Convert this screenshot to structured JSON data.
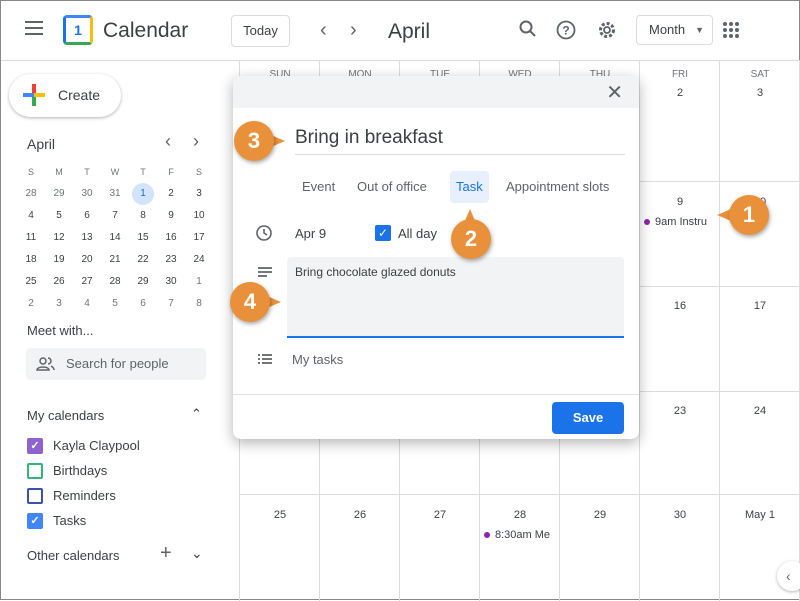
{
  "header": {
    "app_title": "Calendar",
    "logo_number": "1",
    "today_label": "Today",
    "month_label": "April",
    "view_label": "Month",
    "prev": "‹",
    "next": "›"
  },
  "sidebar": {
    "create_label": "Create",
    "mini_calendar": {
      "month": "April",
      "weekdays": [
        "S",
        "M",
        "T",
        "W",
        "T",
        "F",
        "S"
      ],
      "weeks": [
        [
          "28",
          "29",
          "30",
          "31",
          "1",
          "2",
          "3"
        ],
        [
          "4",
          "5",
          "6",
          "7",
          "8",
          "9",
          "10"
        ],
        [
          "11",
          "12",
          "13",
          "14",
          "15",
          "16",
          "17"
        ],
        [
          "18",
          "19",
          "20",
          "21",
          "22",
          "23",
          "24"
        ],
        [
          "25",
          "26",
          "27",
          "28",
          "29",
          "30",
          "1"
        ],
        [
          "2",
          "3",
          "4",
          "5",
          "6",
          "7",
          "8"
        ]
      ],
      "today": "1"
    },
    "meet_with_label": "Meet with...",
    "search_people_placeholder": "Search for people",
    "my_calendars_label": "My calendars",
    "my_calendars": [
      {
        "label": "Kayla Claypool",
        "color": "#8e63ce",
        "checked": true
      },
      {
        "label": "Birthdays",
        "color": "#33b679",
        "checked": false
      },
      {
        "label": "Reminders",
        "color": "#3f51b5",
        "checked": false
      },
      {
        "label": "Tasks",
        "color": "#4285f4",
        "checked": true
      }
    ],
    "other_calendars_label": "Other calendars"
  },
  "month_grid": {
    "weekdays": [
      "SUN",
      "MON",
      "TUE",
      "WED",
      "THU",
      "FRI",
      "SAT"
    ],
    "visible_days": {
      "fri": [
        "2",
        "9",
        "16",
        "23",
        "30"
      ],
      "sat": [
        "3",
        "10",
        "17",
        "24",
        "May 1"
      ],
      "last_row": [
        "25",
        "26",
        "27",
        "28",
        "29"
      ]
    },
    "events": [
      {
        "day": "9",
        "text": "9am Instru"
      },
      {
        "day": "28",
        "text": "8:30am Me"
      }
    ]
  },
  "dialog": {
    "title": "Bring in breakfast",
    "tabs": [
      "Event",
      "Out of office",
      "Task",
      "Appointment slots"
    ],
    "active_tab": "Task",
    "date": "Apr 9",
    "all_day_label": "All day",
    "all_day_checked": true,
    "description": "Bring chocolate glazed donuts",
    "task_list": "My tasks",
    "save_label": "Save"
  },
  "callouts": [
    "1",
    "2",
    "3",
    "4"
  ],
  "colors": {
    "accent": "#1a73e8",
    "callout": "#e8913a",
    "event_dot": "#8e24aa"
  }
}
